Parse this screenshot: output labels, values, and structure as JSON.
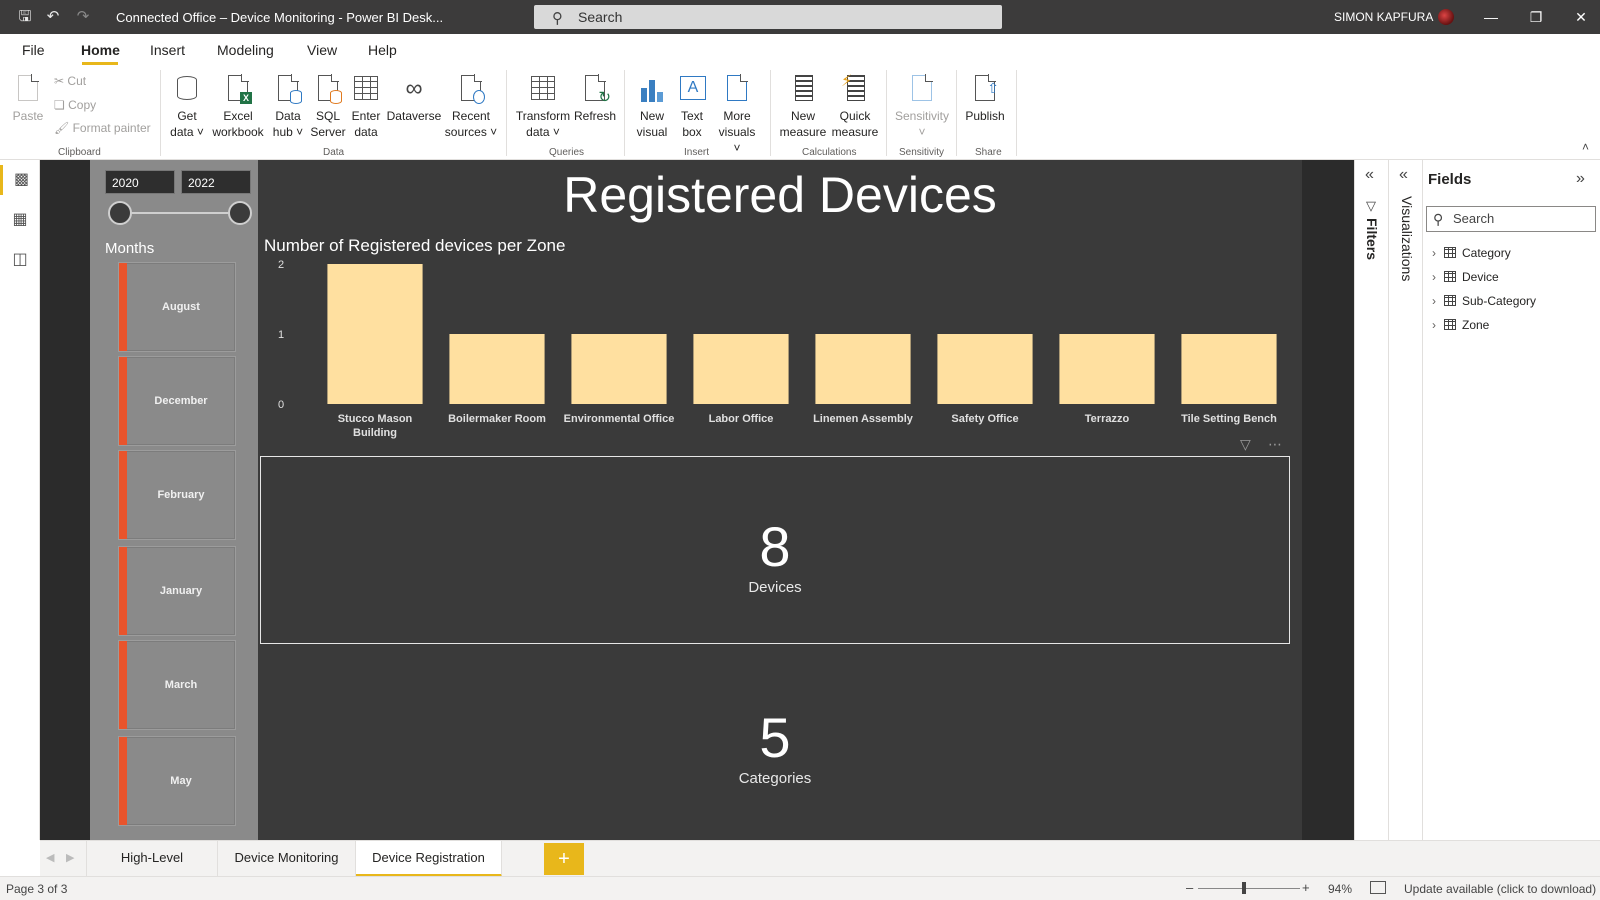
{
  "window": {
    "title": "Connected Office – Device Monitoring - Power BI Desk...",
    "search_placeholder": "Search",
    "user_name": "SIMON KAPFURA"
  },
  "menu": {
    "tabs": [
      "File",
      "Home",
      "Insert",
      "Modeling",
      "View",
      "Help"
    ],
    "active": "Home"
  },
  "ribbon": {
    "clipboard": {
      "paste": "Paste",
      "cut": "Cut",
      "copy": "Copy",
      "format_painter": "Format painter",
      "label": "Clipboard"
    },
    "data": {
      "get_data": [
        "Get",
        "data"
      ],
      "excel_workbook": [
        "Excel",
        "workbook"
      ],
      "data_hub": [
        "Data",
        "hub"
      ],
      "sql_server": [
        "SQL",
        "Server"
      ],
      "enter_data": [
        "Enter",
        "data"
      ],
      "dataverse": "Dataverse",
      "recent_sources": [
        "Recent",
        "sources"
      ],
      "label": "Data"
    },
    "queries": {
      "transform_data": [
        "Transform",
        "data"
      ],
      "refresh": "Refresh",
      "label": "Queries"
    },
    "insert": {
      "new_visual": [
        "New",
        "visual"
      ],
      "text_box": [
        "Text",
        "box"
      ],
      "more_visuals": [
        "More",
        "visuals"
      ],
      "label": "Insert"
    },
    "calculations": {
      "new_measure": [
        "New",
        "measure"
      ],
      "quick_measure": [
        "Quick",
        "measure"
      ],
      "label": "Calculations"
    },
    "sensitivity": {
      "button": "Sensitivity",
      "label": "Sensitivity"
    },
    "share": {
      "publish": "Publish",
      "label": "Share"
    }
  },
  "report": {
    "title": "Registered Devices",
    "date_slicer": {
      "start": "2020",
      "end": "2022"
    },
    "months_title": "Months",
    "months": [
      "August",
      "December",
      "February",
      "January",
      "March",
      "May"
    ],
    "month_bar_color": "#e8542c",
    "cards": [
      {
        "value": "8",
        "label": "Devices"
      },
      {
        "value": "5",
        "label": "Categories"
      }
    ]
  },
  "chart_data": {
    "type": "bar",
    "title": "Number of Registered devices per Zone",
    "categories": [
      "Stucco Mason Building",
      "Boilermaker Room",
      "Environmental Office",
      "Labor Office",
      "Linemen Assembly",
      "Safety Office",
      "Terrazzo",
      "Tile Setting Bench"
    ],
    "values": [
      2,
      1,
      1,
      1,
      1,
      1,
      1,
      1
    ],
    "ylim": [
      0,
      2
    ],
    "yticks": [
      0,
      1,
      2
    ],
    "bar_color": "#ffe0a0",
    "grid": false,
    "xlabel": "",
    "ylabel": ""
  },
  "panes": {
    "filters": "Filters",
    "visualizations": "Visualizations",
    "fields_title": "Fields",
    "fields_search": "Search",
    "fields": [
      "Category",
      "Device",
      "Sub-Category",
      "Zone"
    ]
  },
  "pages": {
    "tabs": [
      "High-Level Metrics",
      "Device Monitoring",
      "Device Registration"
    ],
    "active": "Device Registration",
    "add": "+"
  },
  "status": {
    "page_info": "Page 3 of 3",
    "zoom": "94%",
    "zoom_level": 0.45,
    "update": "Update available (click to download)"
  },
  "colors": {
    "accent": "#e8b71b",
    "canvas": "#3a3a3a"
  }
}
